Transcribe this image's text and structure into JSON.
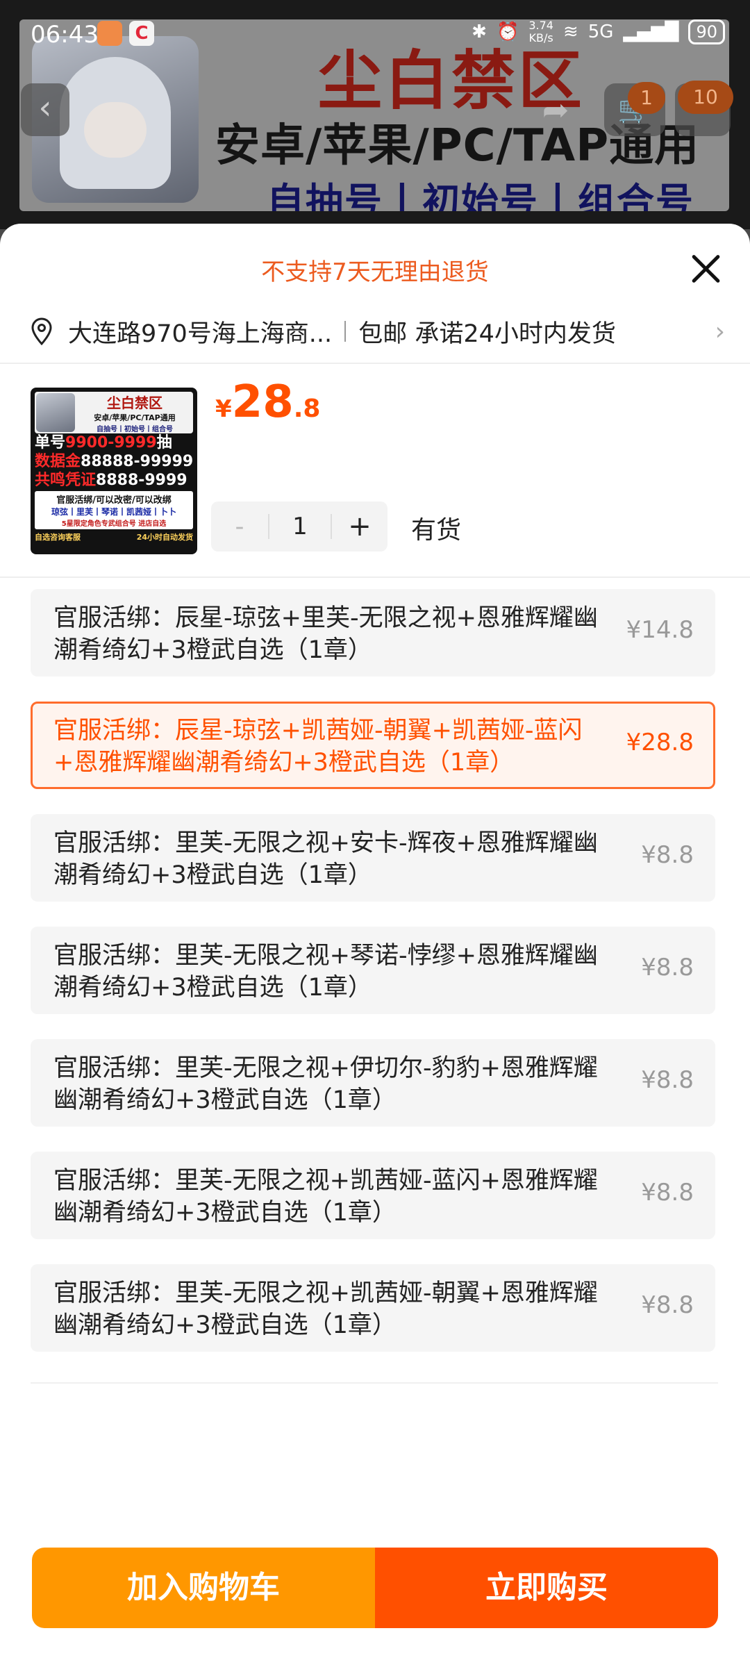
{
  "status_bar": {
    "time": "06:43",
    "app_icon_2": "C",
    "net_speed_value": "3.74",
    "net_speed_unit": "KB/s",
    "network": "5G",
    "battery": "90"
  },
  "banner": {
    "title": "尘白禁区",
    "line2": "安卓/苹果/PC/TAP通用",
    "line3": "自抽号丨初始号丨组合号"
  },
  "nav": {
    "cart_badge": "1",
    "more_badge": "10"
  },
  "sheet": {
    "notice": "不支持7天无理由退货",
    "address": "大连路970号海上海商...",
    "shipping": "包邮 承诺24小时内发货",
    "price_currency": "¥",
    "price_int": "28",
    "price_dec": ".8",
    "qty_minus": "-",
    "qty_value": "1",
    "qty_plus": "+",
    "stock": "有货"
  },
  "thumbnail": {
    "title": "尘白禁区",
    "sub": "安卓/苹果/PC/TAP通用",
    "sub2": "自抽号丨初始号丨组合号",
    "line1_a": "单号",
    "line1_b": "9900-9999",
    "line1_c": "抽",
    "line2_a": "数据金",
    "line2_b": "88888-99999",
    "line3_a": "共鸣凭证",
    "line3_b": "8888-9999",
    "box1": "官服活绑/可以改密/可以改绑",
    "box2": "琼弦丨里芙丨琴诺丨凯茜娅丨卜卜",
    "box3": "5星限定角色专武组合号 进店自选",
    "foot_left": "自选咨询客服",
    "foot_right": "24小时自动发货"
  },
  "options": [
    {
      "name": "官服活绑：辰星-琼弦+里芙-无限之视+恩雅辉耀幽潮肴绮幻+3橙武自选（1章）",
      "price": "¥14.8",
      "selected": false
    },
    {
      "name": "官服活绑：辰星-琼弦+凯茜娅-朝翼+凯茜娅-蓝闪+恩雅辉耀幽潮肴绮幻+3橙武自选（1章）",
      "price": "¥28.8",
      "selected": true
    },
    {
      "name": "官服活绑：里芙-无限之视+安卡-辉夜+恩雅辉耀幽潮肴绮幻+3橙武自选（1章）",
      "price": "¥8.8",
      "selected": false
    },
    {
      "name": "官服活绑：里芙-无限之视+琴诺-悖缪+恩雅辉耀幽潮肴绮幻+3橙武自选（1章）",
      "price": "¥8.8",
      "selected": false
    },
    {
      "name": "官服活绑：里芙-无限之视+伊切尔-豹豹+恩雅辉耀幽潮肴绮幻+3橙武自选（1章）",
      "price": "¥8.8",
      "selected": false
    },
    {
      "name": "官服活绑：里芙-无限之视+凯茜娅-蓝闪+恩雅辉耀幽潮肴绮幻+3橙武自选（1章）",
      "price": "¥8.8",
      "selected": false
    },
    {
      "name": "官服活绑：里芙-无限之视+凯茜娅-朝翼+恩雅辉耀幽潮肴绮幻+3橙武自选（1章）",
      "price": "¥8.8",
      "selected": false
    }
  ],
  "actions": {
    "add_to_cart": "加入购物车",
    "buy_now": "立即购买"
  },
  "colors": {
    "accent": "#ff5000",
    "cart_button": "#ff9700",
    "notice_text": "#ec5b1f"
  },
  "icons": [
    "location-pin-icon",
    "close-icon",
    "chevron-right-icon",
    "back-arrow-icon",
    "share-icon",
    "cart-icon"
  ]
}
